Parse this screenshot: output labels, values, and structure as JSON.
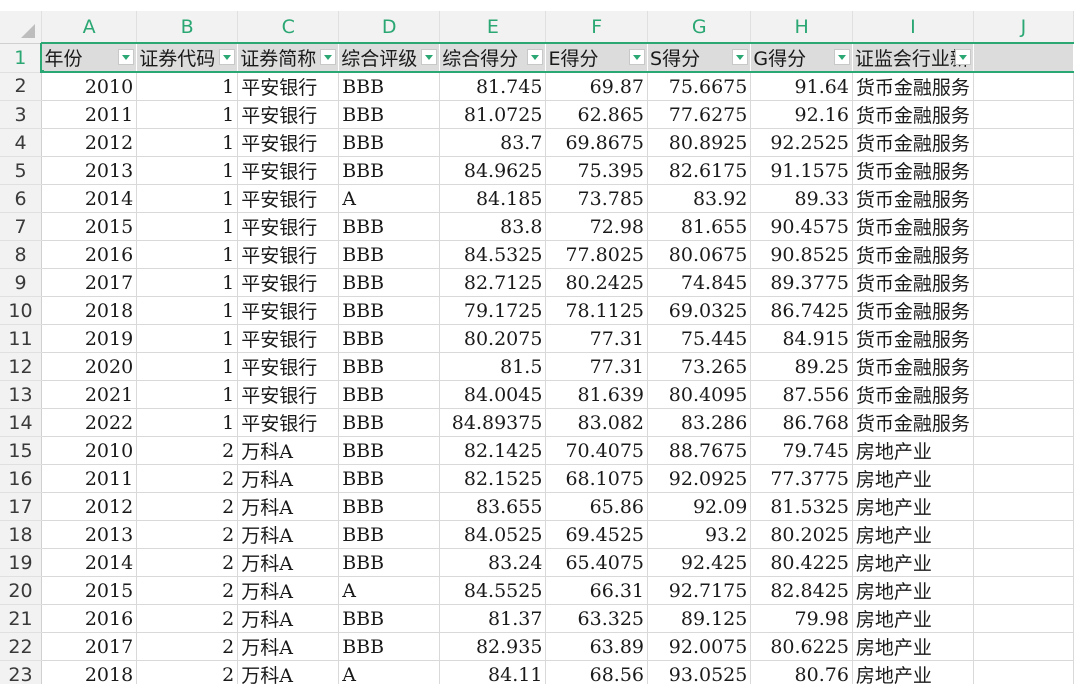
{
  "columns": [
    "A",
    "B",
    "C",
    "D",
    "E",
    "F",
    "G",
    "H",
    "I",
    "J"
  ],
  "header_row": {
    "row_number": "1",
    "cells": [
      "年份",
      "证券代码",
      "证券简称",
      "综合评级",
      "综合得分",
      "E得分",
      "S得分",
      "G得分",
      "证监会行业新",
      ""
    ]
  },
  "rows": [
    {
      "n": "2",
      "year": "2010",
      "code": "1",
      "name": "平安银行",
      "rating": "BBB",
      "score": "81.745",
      "e": "69.87",
      "s": "75.6675",
      "g": "91.64",
      "industry": "货币金融服务"
    },
    {
      "n": "3",
      "year": "2011",
      "code": "1",
      "name": "平安银行",
      "rating": "BBB",
      "score": "81.0725",
      "e": "62.865",
      "s": "77.6275",
      "g": "92.16",
      "industry": "货币金融服务"
    },
    {
      "n": "4",
      "year": "2012",
      "code": "1",
      "name": "平安银行",
      "rating": "BBB",
      "score": "83.7",
      "e": "69.8675",
      "s": "80.8925",
      "g": "92.2525",
      "industry": "货币金融服务"
    },
    {
      "n": "5",
      "year": "2013",
      "code": "1",
      "name": "平安银行",
      "rating": "BBB",
      "score": "84.9625",
      "e": "75.395",
      "s": "82.6175",
      "g": "91.1575",
      "industry": "货币金融服务"
    },
    {
      "n": "6",
      "year": "2014",
      "code": "1",
      "name": "平安银行",
      "rating": "A",
      "score": "84.185",
      "e": "73.785",
      "s": "83.92",
      "g": "89.33",
      "industry": "货币金融服务"
    },
    {
      "n": "7",
      "year": "2015",
      "code": "1",
      "name": "平安银行",
      "rating": "BBB",
      "score": "83.8",
      "e": "72.98",
      "s": "81.655",
      "g": "90.4575",
      "industry": "货币金融服务"
    },
    {
      "n": "8",
      "year": "2016",
      "code": "1",
      "name": "平安银行",
      "rating": "BBB",
      "score": "84.5325",
      "e": "77.8025",
      "s": "80.0675",
      "g": "90.8525",
      "industry": "货币金融服务"
    },
    {
      "n": "9",
      "year": "2017",
      "code": "1",
      "name": "平安银行",
      "rating": "BBB",
      "score": "82.7125",
      "e": "80.2425",
      "s": "74.845",
      "g": "89.3775",
      "industry": "货币金融服务"
    },
    {
      "n": "10",
      "year": "2018",
      "code": "1",
      "name": "平安银行",
      "rating": "BBB",
      "score": "79.1725",
      "e": "78.1125",
      "s": "69.0325",
      "g": "86.7425",
      "industry": "货币金融服务"
    },
    {
      "n": "11",
      "year": "2019",
      "code": "1",
      "name": "平安银行",
      "rating": "BBB",
      "score": "80.2075",
      "e": "77.31",
      "s": "75.445",
      "g": "84.915",
      "industry": "货币金融服务"
    },
    {
      "n": "12",
      "year": "2020",
      "code": "1",
      "name": "平安银行",
      "rating": "BBB",
      "score": "81.5",
      "e": "77.31",
      "s": "73.265",
      "g": "89.25",
      "industry": "货币金融服务"
    },
    {
      "n": "13",
      "year": "2021",
      "code": "1",
      "name": "平安银行",
      "rating": "BBB",
      "score": "84.0045",
      "e": "81.639",
      "s": "80.4095",
      "g": "87.556",
      "industry": "货币金融服务"
    },
    {
      "n": "14",
      "year": "2022",
      "code": "1",
      "name": "平安银行",
      "rating": "BBB",
      "score": "84.89375",
      "e": "83.082",
      "s": "83.286",
      "g": "86.768",
      "industry": "货币金融服务"
    },
    {
      "n": "15",
      "year": "2010",
      "code": "2",
      "name": "万科A",
      "rating": "BBB",
      "score": "82.1425",
      "e": "70.4075",
      "s": "88.7675",
      "g": "79.745",
      "industry": "房地产业"
    },
    {
      "n": "16",
      "year": "2011",
      "code": "2",
      "name": "万科A",
      "rating": "BBB",
      "score": "82.1525",
      "e": "68.1075",
      "s": "92.0925",
      "g": "77.3775",
      "industry": "房地产业"
    },
    {
      "n": "17",
      "year": "2012",
      "code": "2",
      "name": "万科A",
      "rating": "BBB",
      "score": "83.655",
      "e": "65.86",
      "s": "92.09",
      "g": "81.5325",
      "industry": "房地产业"
    },
    {
      "n": "18",
      "year": "2013",
      "code": "2",
      "name": "万科A",
      "rating": "BBB",
      "score": "84.0525",
      "e": "69.4525",
      "s": "93.2",
      "g": "80.2025",
      "industry": "房地产业"
    },
    {
      "n": "19",
      "year": "2014",
      "code": "2",
      "name": "万科A",
      "rating": "BBB",
      "score": "83.24",
      "e": "65.4075",
      "s": "92.425",
      "g": "80.4225",
      "industry": "房地产业"
    },
    {
      "n": "20",
      "year": "2015",
      "code": "2",
      "name": "万科A",
      "rating": "A",
      "score": "84.5525",
      "e": "66.31",
      "s": "92.7175",
      "g": "82.8425",
      "industry": "房地产业"
    },
    {
      "n": "21",
      "year": "2016",
      "code": "2",
      "name": "万科A",
      "rating": "BBB",
      "score": "81.37",
      "e": "63.325",
      "s": "89.125",
      "g": "79.98",
      "industry": "房地产业"
    },
    {
      "n": "22",
      "year": "2017",
      "code": "2",
      "name": "万科A",
      "rating": "BBB",
      "score": "82.935",
      "e": "63.89",
      "s": "92.0075",
      "g": "80.6225",
      "industry": "房地产业"
    },
    {
      "n": "23",
      "year": "2018",
      "code": "2",
      "name": "万科A",
      "rating": "A",
      "score": "84.11",
      "e": "68.56",
      "s": "93.0525",
      "g": "80.76",
      "industry": "房地产业"
    }
  ],
  "colors": {
    "accent": "#2aa773",
    "header_bg": "#f2f2f2",
    "header_row_bg": "#dcdcdc",
    "grid_line": "#d9d9d9"
  }
}
